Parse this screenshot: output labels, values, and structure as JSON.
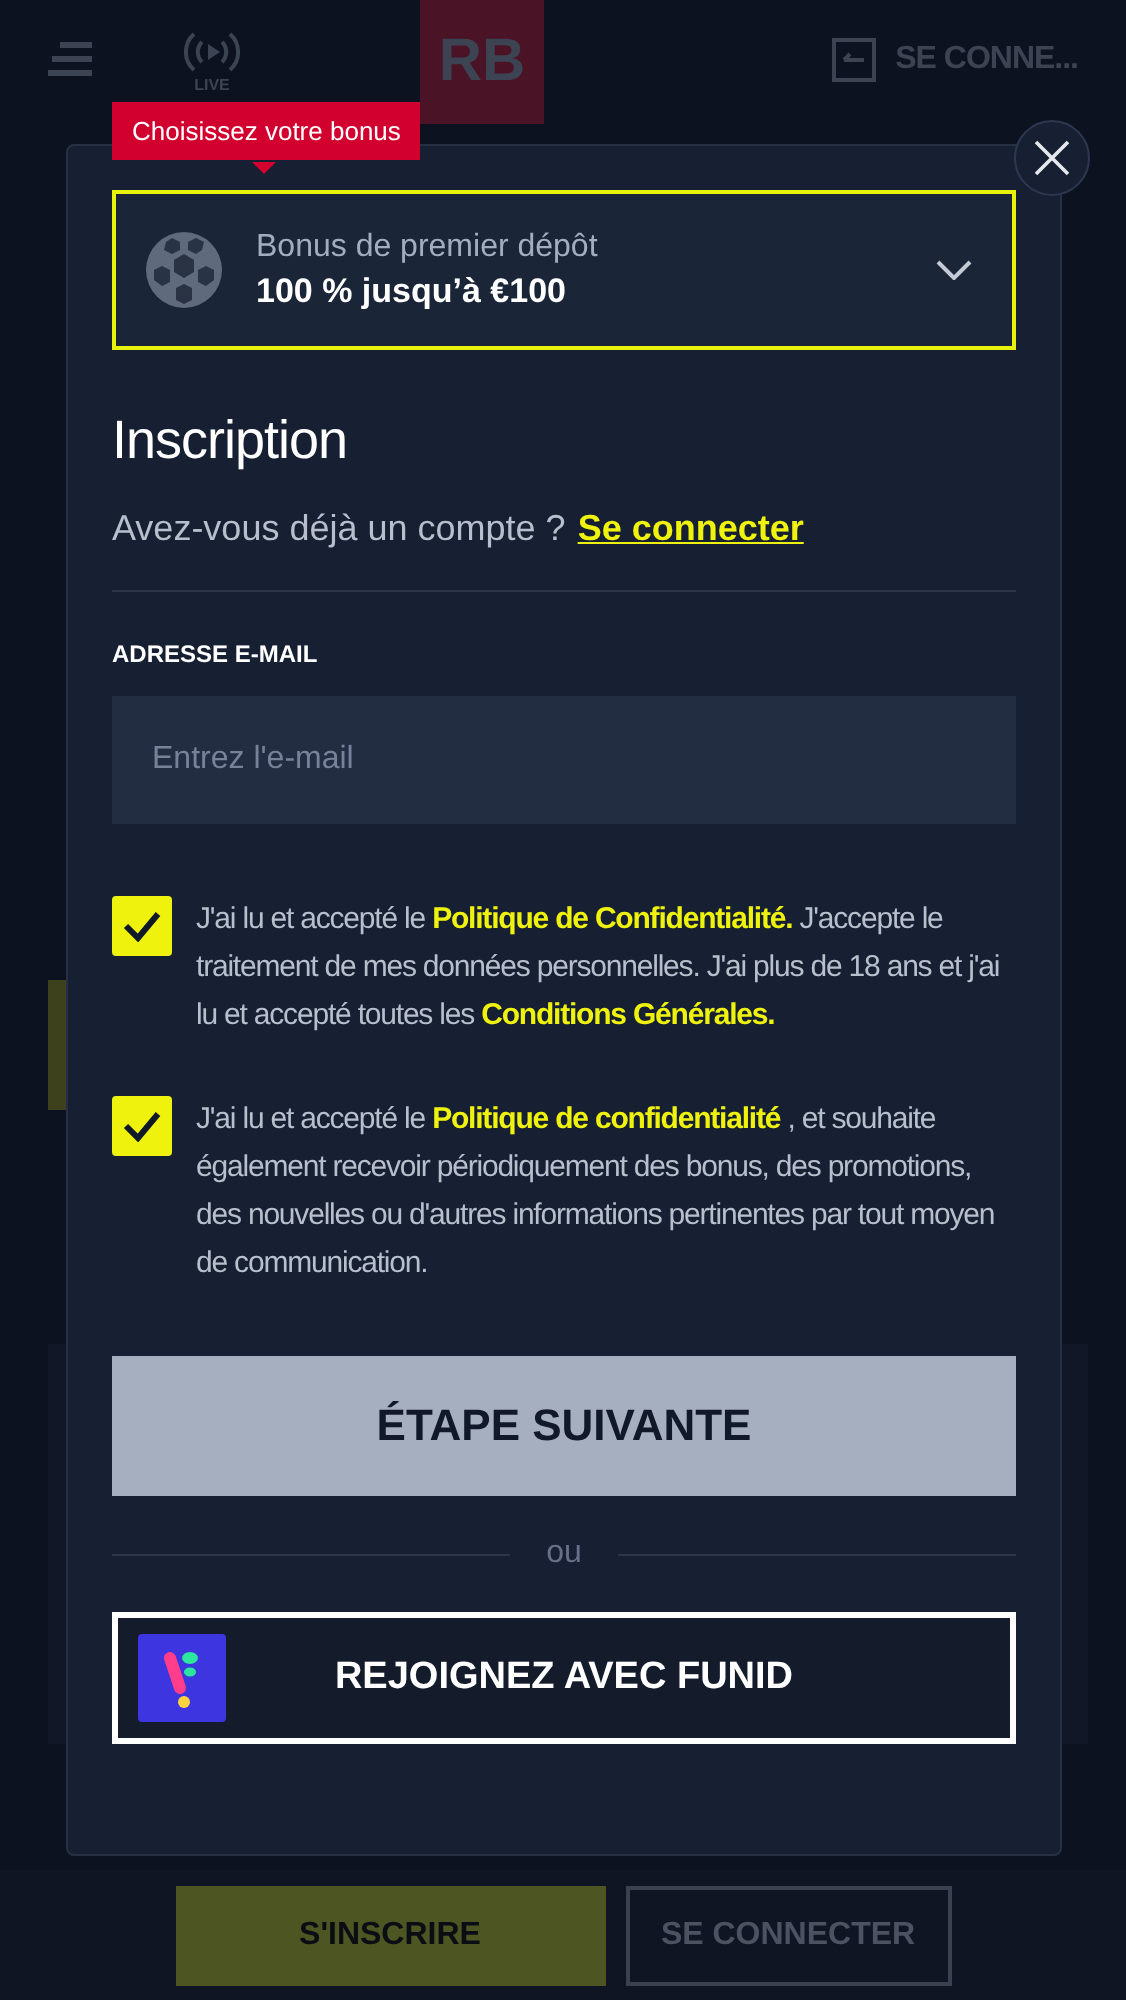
{
  "header": {
    "live_label": "LIVE",
    "logo": "RB",
    "login_label": "SE CONNE..."
  },
  "bonus_tooltip": "Choisissez votre bonus",
  "bonus": {
    "title": "Bonus de premier dépôt",
    "amount": "100 % jusqu’à €100"
  },
  "heading": "Inscription",
  "login_prompt": {
    "text": "Avez-vous déjà un compte ?",
    "link": "Se connecter"
  },
  "email": {
    "label": "ADRESSE E-MAIL",
    "placeholder": "Entrez l'e-mail"
  },
  "consents": [
    {
      "checked": true,
      "parts": [
        {
          "text": "J'ai lu et accepté le ",
          "kind": "text"
        },
        {
          "text": "Politique de Confidentialité.",
          "kind": "link"
        },
        {
          "text": " J'accepte le traitement de mes données personnelles. J'ai plus de 18 ans et j'ai lu et accepté toutes les ",
          "kind": "text"
        },
        {
          "text": "Conditions Générales.",
          "kind": "link"
        }
      ]
    },
    {
      "checked": true,
      "parts": [
        {
          "text": "J'ai lu et accepté le  ",
          "kind": "text"
        },
        {
          "text": "Politique de confidentialité",
          "kind": "link"
        },
        {
          "text": " , et souhaite également recevoir périodiquement des bonus, des promotions, des nouvelles ou d'autres informations pertinentes par tout moyen de communication.",
          "kind": "text"
        }
      ]
    }
  ],
  "next_button": "ÉTAPE SUIVANTE",
  "separator": "ou",
  "funid_button": "REJOIGNEZ AVEC FUNID",
  "bottom_bar": {
    "signup": "S'INSCRIRE",
    "login": "SE CONNECTER"
  }
}
